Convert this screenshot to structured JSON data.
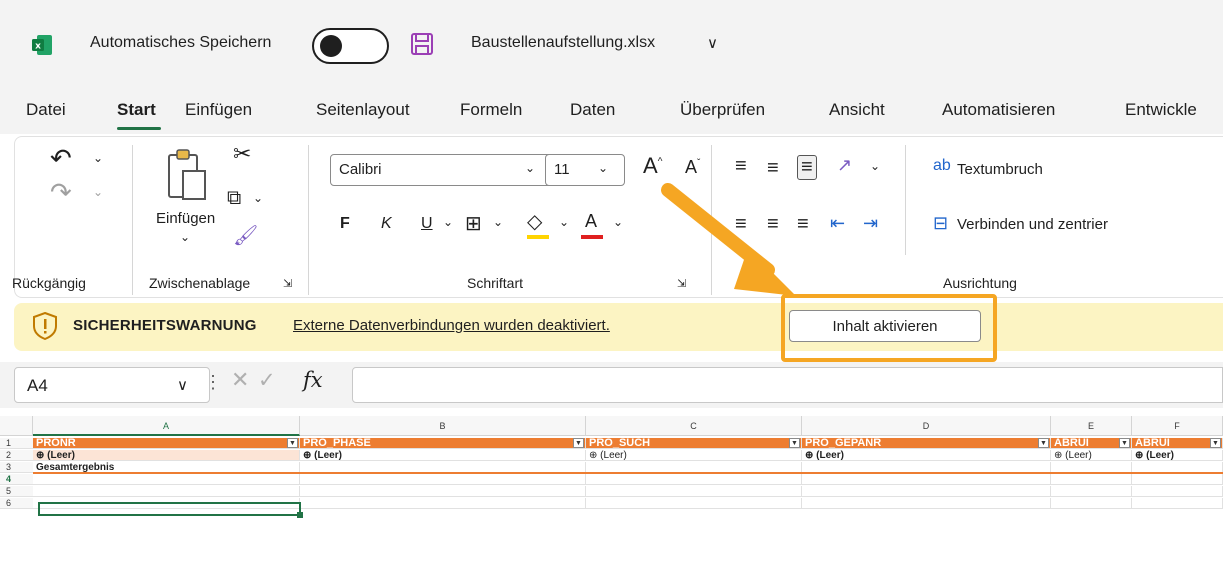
{
  "titlebar": {
    "autosave_label": "Automatisches Speichern",
    "file_name": "Baustellenaufstellung.xlsx",
    "file_chevron": "∨"
  },
  "tabs": [
    "Datei",
    "Start",
    "Einfügen",
    "Seitenlayout",
    "Formeln",
    "Daten",
    "Überprüfen",
    "Ansicht",
    "Automatisieren",
    "Entwickle"
  ],
  "active_tab": "Start",
  "ribbon": {
    "undo_group_label": "Rückgängig",
    "clipboard_group_label": "Zwischenablage",
    "paste_label": "Einfügen",
    "font_group_label": "Schriftart",
    "alignment_group_label": "Ausrichtung",
    "font_name": "Calibri",
    "font_size": "11",
    "bold": "F",
    "italic": "K",
    "underline": "U",
    "wrap_text": "Textumbruch",
    "merge_center": "Verbinden und zentrier"
  },
  "security_bar": {
    "title": "SICHERHEITSWARNUNG",
    "message": "Externe Datenverbindungen wurden deaktiviert.",
    "button_label": "Inhalt aktivieren"
  },
  "formula_bar": {
    "name_box": "A4",
    "fx": "fx",
    "value": ""
  },
  "grid": {
    "columns": [
      "A",
      "B",
      "C",
      "D",
      "E",
      "F"
    ],
    "rows": [
      "1",
      "2",
      "3",
      "4",
      "5",
      "6"
    ],
    "header_fields": [
      "PRONR",
      "PRO_PHASE",
      "PRO_SUCH",
      "PRO_GEPANR",
      "ABRUI",
      "ABRUI"
    ],
    "leer": "(Leer)",
    "total_label": "Gesamtergebnis"
  },
  "colors": {
    "accent_green": "#217346",
    "pivot_orange": "#ed7d31",
    "warning_yellow": "#fcf4c3",
    "highlight_orange": "#f5a623"
  }
}
